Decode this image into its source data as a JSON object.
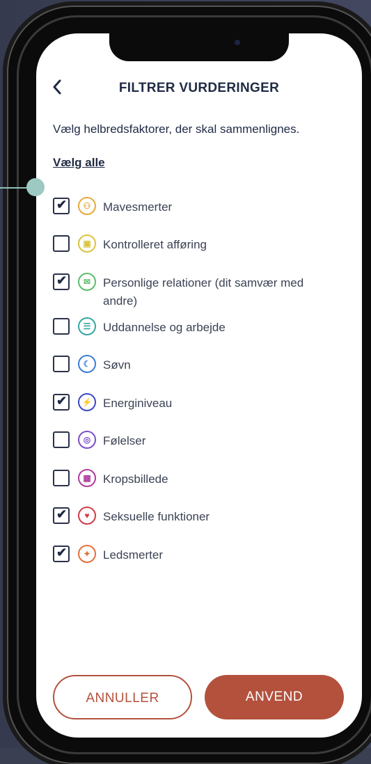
{
  "header": {
    "back_icon": "chevron-left",
    "title": "FILTRER VURDERINGER"
  },
  "subtitle": "Vælg helbredsfaktorer, der skal sammenlignes.",
  "select_all": "Vælg alle",
  "factors": [
    {
      "label": "Mavesmerter",
      "checked": true,
      "icon": "stomach-icon",
      "color": "#e8a93a"
    },
    {
      "label": "Kontrolleret afføring",
      "checked": false,
      "icon": "toilet-icon",
      "color": "#d9c43a"
    },
    {
      "label": "Personlige relationer (dit samvær med andre)",
      "checked": true,
      "icon": "chat-icon",
      "color": "#5bbd6a"
    },
    {
      "label": "Uddannelse og arbejde",
      "checked": false,
      "icon": "document-icon",
      "color": "#34a6a0"
    },
    {
      "label": "Søvn",
      "checked": false,
      "icon": "moon-icon",
      "color": "#3b7dd8"
    },
    {
      "label": "Energiniveau",
      "checked": true,
      "icon": "lightning-icon",
      "color": "#3b48c4"
    },
    {
      "label": "Følelser",
      "checked": false,
      "icon": "emotions-icon",
      "color": "#7b4fc9"
    },
    {
      "label": "Kropsbillede",
      "checked": false,
      "icon": "body-image-icon",
      "color": "#b03a9f"
    },
    {
      "label": "Seksuelle funktioner",
      "checked": true,
      "icon": "heart-icon",
      "color": "#d23b4a"
    },
    {
      "label": "Ledsmerter",
      "checked": true,
      "icon": "joint-icon",
      "color": "#e2703a"
    }
  ],
  "buttons": {
    "cancel": "ANNULLER",
    "apply": "ANVEND"
  },
  "colors": {
    "accent": "#b3513d",
    "text_dark": "#1f2a44",
    "callout": "#9cc9c1"
  }
}
